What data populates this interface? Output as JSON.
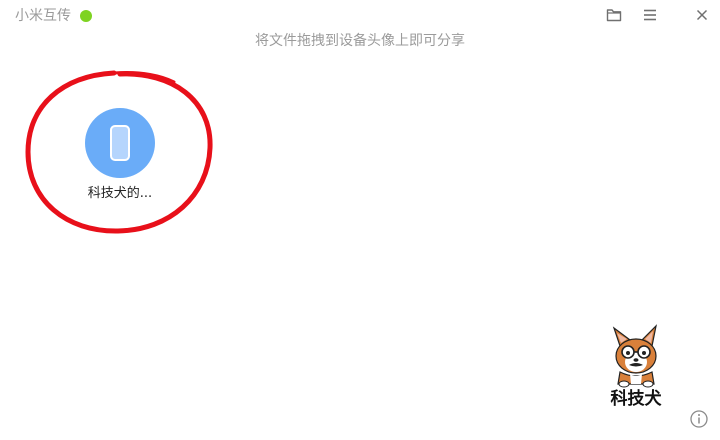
{
  "window": {
    "app_title": "小米互传",
    "online_status_color": "#7ed321"
  },
  "toolbar": {
    "icons": [
      "folder-icon",
      "menu-icon",
      "close-icon"
    ]
  },
  "hint": {
    "text": "将文件拖拽到设备头像上即可分享"
  },
  "devices": [
    {
      "label": "科技犬的...",
      "icon": "phone-icon",
      "avatar_color": "#6aacf8"
    }
  ],
  "annotation": {
    "color": "#e8101a"
  },
  "watermark": {
    "text": "科技犬"
  },
  "footer": {
    "icon": "info-icon"
  }
}
